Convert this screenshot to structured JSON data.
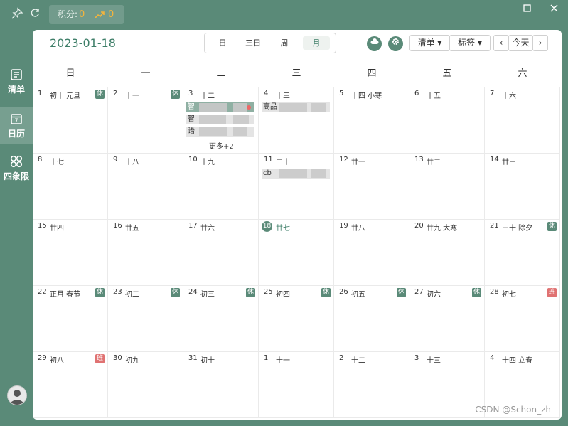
{
  "topbar": {
    "score_label": "积分:",
    "score_value": "0",
    "trend_value": "0",
    "trend_icon": "trend-up-icon"
  },
  "sidebar": {
    "items": [
      {
        "label": "清单",
        "icon": "list-icon"
      },
      {
        "label": "日历",
        "icon": "calendar-icon",
        "icon_text": "7"
      },
      {
        "label": "四象限",
        "icon": "quadrant-icon"
      }
    ]
  },
  "header": {
    "date": "2023-01-18",
    "view_tabs": [
      "日",
      "三日",
      "周",
      "月"
    ],
    "active_view": "月",
    "list_button": "清单 ▾",
    "tag_button": "标签 ▾",
    "today_button": "今天",
    "prev": "‹",
    "next": "›"
  },
  "weekdays": [
    "日",
    "一",
    "二",
    "三",
    "四",
    "五",
    "六"
  ],
  "weeks": [
    [
      {
        "d": "1",
        "l": "初十 元旦",
        "tag": "休"
      },
      {
        "d": "2",
        "l": "十一",
        "tag": "休"
      },
      {
        "d": "3",
        "l": "十二",
        "events": [
          {
            "text": "智",
            "style": "dark",
            "dot": true
          },
          {
            "text": "智",
            "style": "gray"
          },
          {
            "text": "语",
            "style": "gray"
          }
        ],
        "more": "更多+2"
      },
      {
        "d": "4",
        "l": "十三",
        "events": [
          {
            "text": "高品",
            "style": "gray"
          }
        ]
      },
      {
        "d": "5",
        "l": "十四 小寒"
      },
      {
        "d": "6",
        "l": "十五"
      },
      {
        "d": "7",
        "l": "十六"
      }
    ],
    [
      {
        "d": "8",
        "l": "十七"
      },
      {
        "d": "9",
        "l": "十八"
      },
      {
        "d": "10",
        "l": "十九"
      },
      {
        "d": "11",
        "l": "二十",
        "events": [
          {
            "text": "cb",
            "style": "gray"
          }
        ]
      },
      {
        "d": "12",
        "l": "廿一"
      },
      {
        "d": "13",
        "l": "廿二"
      },
      {
        "d": "14",
        "l": "廿三"
      }
    ],
    [
      {
        "d": "15",
        "l": "廿四"
      },
      {
        "d": "16",
        "l": "廿五"
      },
      {
        "d": "17",
        "l": "廿六"
      },
      {
        "d": "18",
        "l": "廿七",
        "today": true
      },
      {
        "d": "19",
        "l": "廿八"
      },
      {
        "d": "20",
        "l": "廿九 大寒"
      },
      {
        "d": "21",
        "l": "三十 除夕",
        "tag": "休"
      }
    ],
    [
      {
        "d": "22",
        "l": "正月 春节",
        "tag": "休"
      },
      {
        "d": "23",
        "l": "初二",
        "tag": "休"
      },
      {
        "d": "24",
        "l": "初三",
        "tag": "休"
      },
      {
        "d": "25",
        "l": "初四",
        "tag": "休"
      },
      {
        "d": "26",
        "l": "初五",
        "tag": "休"
      },
      {
        "d": "27",
        "l": "初六",
        "tag": "休"
      },
      {
        "d": "28",
        "l": "初七",
        "tag": "班"
      }
    ],
    [
      {
        "d": "29",
        "l": "初八",
        "tag": "班"
      },
      {
        "d": "30",
        "l": "初九"
      },
      {
        "d": "31",
        "l": "初十"
      },
      {
        "d": "1",
        "l": "十一"
      },
      {
        "d": "2",
        "l": "十二"
      },
      {
        "d": "3",
        "l": "十三"
      },
      {
        "d": "4",
        "l": "十四 立春"
      }
    ]
  ],
  "watermark": "CSDN @Schon_zh"
}
